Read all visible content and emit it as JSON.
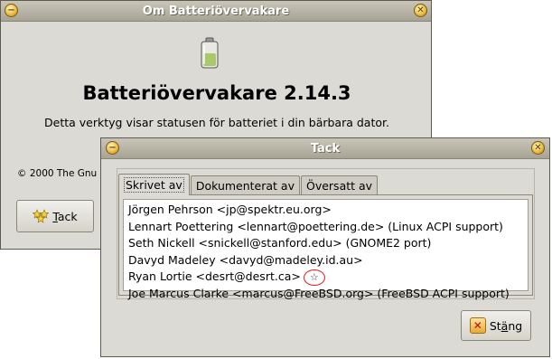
{
  "about_window": {
    "title": "Om Batteriövervakare",
    "minimize_glyph": "−",
    "close_glyph": "✕",
    "app_name": "Batteriövervakare 2.14.3",
    "description": "Detta verktyg visar statusen för batteriet i din bärbara dator.",
    "copyright": "© 2000 The Gnu",
    "credits_button": {
      "label_underlined": "T",
      "label_rest": "ack",
      "icon": "stars-icon"
    },
    "app_icon": "battery-icon"
  },
  "credits_window": {
    "title": "Tack",
    "minimize_glyph": "−",
    "close_glyph": "✕",
    "tabs": [
      {
        "label": "Skrivet av",
        "active": true
      },
      {
        "label": "Dokumenterat av",
        "active": false
      },
      {
        "label": "Översatt av",
        "active": false
      }
    ],
    "authors": [
      "Jörgen Pehrson <jp@spektr.eu.org>",
      "Lennart Poettering <lennart@poettering.de> (Linux ACPI support)",
      "Seth Nickell <snickell@stanford.edu> (GNOME2 port)",
      "Davyd Madeley <davyd@madeley.id.au>",
      "Ryan Lortie <desrt@desrt.ca>",
      "Joe Marcus Clarke <marcus@FreeBSD.org> (FreeBSD ACPI support)"
    ],
    "annotation_glyph": "☆",
    "close_button": {
      "label_pre": "St",
      "label_underlined": "ä",
      "label_rest": "ng",
      "icon": "close-icon"
    }
  },
  "colors": {
    "window_bg": "#dcdad5",
    "titlebar": "#a7a394",
    "annotation_circle": "#e02020"
  }
}
